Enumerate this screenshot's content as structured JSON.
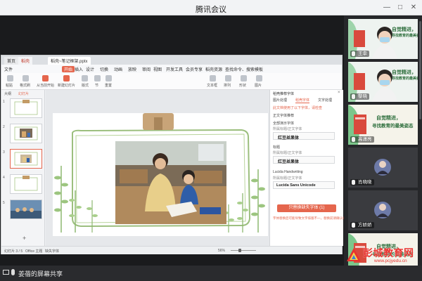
{
  "window": {
    "title": "腾讯会议"
  },
  "wps": {
    "tabs": [
      "首页",
      "稻壳",
      "稻壳~笔记框架.pptx"
    ],
    "menu": [
      "文件",
      "开始",
      "插入",
      "设计",
      "切换",
      "动画",
      "放映",
      "审阅",
      "视图",
      "开发工具",
      "会员专享",
      "稻壳资源",
      "查找命令、搜索模板"
    ],
    "ribbon_labels": [
      "粘贴",
      "格式刷",
      "从当前开始",
      "新建幻灯片",
      "版式",
      "节",
      "重置",
      "文本框",
      "排列",
      "形状",
      "图片"
    ],
    "thumb_panel_tabs": [
      "大纲",
      "幻灯片"
    ],
    "thumbnail_numbers": [
      "1",
      "2",
      "3",
      "4",
      "5"
    ],
    "status": {
      "slide_info": "幻灯片 3 / 5",
      "theme": "Office 主题",
      "missing_font": "缺失字体",
      "zoom": "56%"
    },
    "font_pane": {
      "title": "稻壳推荐字体",
      "tabs": [
        "图片处理",
        "稻壳字体",
        "文字处理"
      ],
      "hint": "此文档使用了以下字体，请检查",
      "section": "正文字体推荐",
      "fonts": [
        {
          "label": "全部演示字体",
          "detail": "所属标题/正文字体",
          "name": "红豆丝果体"
        },
        {
          "label": "标题",
          "detail": "所属标题/正文字体",
          "name": "红豆丝果体"
        },
        {
          "label": "Lucida Handwriting",
          "detail": "所属标题/正文字体",
          "name": "Lucida Sans Unicode"
        }
      ],
      "install_button": "只替换缺失字体 (1)",
      "note": "字体替换后可能导致文字排版不一，替换前请确认排版"
    }
  },
  "participants": [
    {
      "name": "王幸",
      "type": "video",
      "muted": false
    },
    {
      "name": "黎晓",
      "type": "video",
      "muted": false
    },
    {
      "name": "高潇亮",
      "type": "poster",
      "muted": false
    },
    {
      "name": "肖晓晓",
      "type": "avatar",
      "muted": false
    },
    {
      "name": "方娇娇",
      "type": "avatar",
      "muted": false
    },
    {
      "name": "",
      "type": "poster",
      "muted": false
    }
  ],
  "poster": {
    "line1": "自觉精进，",
    "line2": "寻找教育的最美姿态"
  },
  "screen_share": {
    "label": "姜蓓的屏幕共享"
  },
  "watermark": {
    "text": "彭城教育网",
    "url": "www.pcjyedu.cn"
  },
  "colors": {
    "accent": "#e5664d",
    "poster_green": "#7cc68b",
    "book_red": "#d94a3d",
    "watermark": "#e8332f"
  }
}
